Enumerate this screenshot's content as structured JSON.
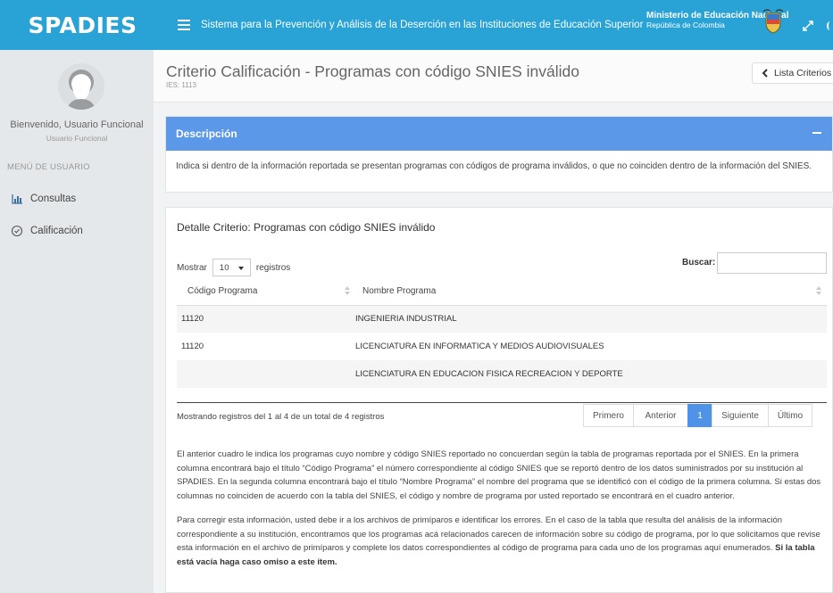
{
  "app": {
    "brand": "SPADIES",
    "system_title": "Sistema para la Prevención y Análisis de la Deserción en las Instituciones de Educación Superior",
    "ministry": "Ministerio de Educación Nacional",
    "ministry_sub": "República de Colombia"
  },
  "sidebar": {
    "welcome": "Bienvenido, Usuario Funcional",
    "role": "Usuario Funcional",
    "menu_header": "MENÚ DE USUARIO",
    "items": [
      {
        "label": "Consultas",
        "icon": "bar-chart-icon"
      },
      {
        "label": "Calificación",
        "icon": "check-circle-icon"
      }
    ]
  },
  "header": {
    "title": "Criterio Calificación - Programas con código SNIES inválido",
    "subtitle": "IES: 1113",
    "back_label": "Lista Criterios"
  },
  "description": {
    "title": "Descripción",
    "text": "Indica si dentro de la información reportada se presentan programas con códigos de programa inválidos, o que no coinciden dentro de la información del SNIES."
  },
  "detail": {
    "title": "Detalle Criterio: Programas con código SNIES inválido",
    "show_prefix": "Mostrar",
    "page_size": "10",
    "show_suffix": "registros",
    "search_label": "Buscar:",
    "columns": [
      "Código Programa",
      "Nombre Programa"
    ],
    "rows": [
      {
        "code": "11120",
        "name": "INGENIERIA INDUSTRIAL"
      },
      {
        "code": "11120",
        "name": "LICENCIATURA EN INFORMATICA Y MEDIOS AUDIOVISUALES"
      },
      {
        "code": "",
        "name": "LICENCIATURA EN EDUCACION FISICA RECREACION Y DEPORTE"
      }
    ],
    "info": "Mostrando registros del 1 al 4 de un total de 4 registros",
    "pager": {
      "first": "Primero",
      "prev": "Anterior",
      "current": "1",
      "next": "Siguiente",
      "last": "Último"
    },
    "paragraph1": "El anterior cuadro le indica los programas cuyo nombre y código SNIES reportado no concuerdan según la tabla de programas reportada por el SNIES. En la primera columna encontrará bajo el título “Código Programa” el número correspondiente al código SNIES que se reportó dentro de los datos suministrados por su institución al SPADIES. En la segunda columna encontrará bajo el título “Nombre Programa” el nombre del programa que se identificó con el código de la primera columna. Si estas dos columnas no coinciden de acuerdo con la tabla del SNIES, el código y nombre de programa por usted reportado se encontrará en el cuadro anterior.",
    "paragraph2": "Para corregir esta información, usted debe ir a los archivos de primíparos e identificar los errores. En el caso de la tabla que resulta del análisis de la información correspondiente a su institución, encontramos que los programas acá relacionados carecen de información sobre su código de programa, por lo que solicitamos que revise esta información en el archivo de primíparos y complete los datos correspondientes al código de programa para cada uno de los programas aquí enumerados.",
    "paragraph2_bold": "Si la tabla está vacía haga caso omiso a este ítem."
  },
  "colors": {
    "topbar": "#29a3d6",
    "panel_header": "#5b99e8",
    "pager_active": "#4f93e8",
    "sidebar": "#e5e8ea"
  }
}
